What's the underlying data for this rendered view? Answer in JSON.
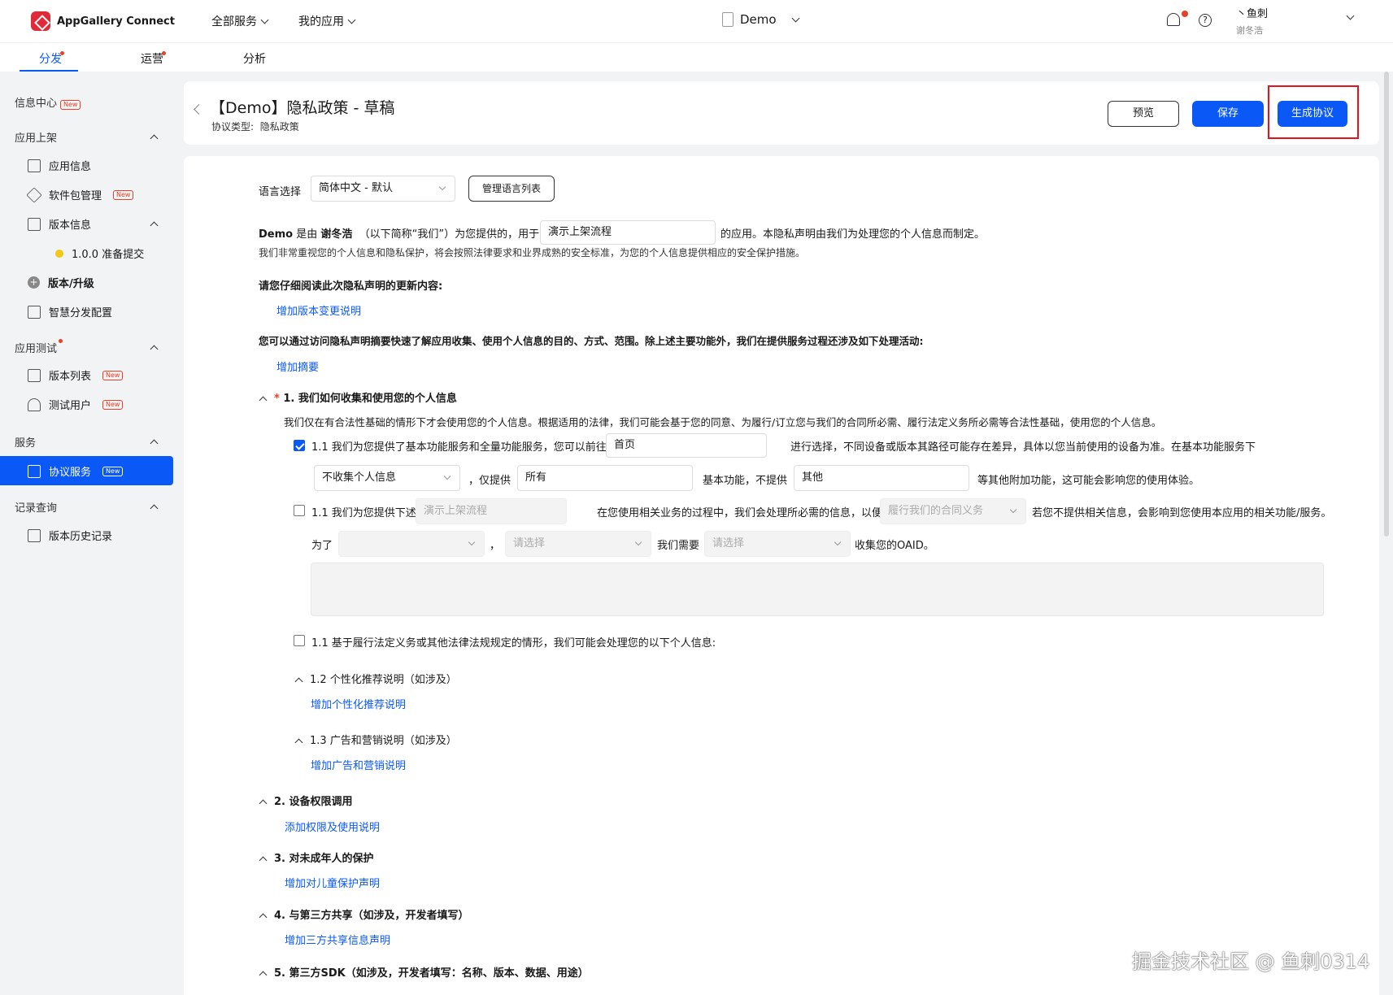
{
  "topbar": {
    "brand": "AppGallery Connect",
    "nav_all_services": "全部服务",
    "nav_my_apps": "我的应用",
    "project": "Demo",
    "user_name": "丶鱼刺",
    "user_sub": "谢冬浩"
  },
  "tabs": [
    "分发",
    "运营",
    "分析"
  ],
  "sidebar": {
    "info_center": "信息中心",
    "sec_release": "应用上架",
    "app_info": "应用信息",
    "package_mgmt": "软件包管理",
    "version_info": "版本信息",
    "version_item": "1.0.0 准备提交",
    "version_upgrade": "版本/升级",
    "smart_dist": "智慧分发配置",
    "sec_testing": "应用测试",
    "version_list": "版本列表",
    "test_users": "测试用户",
    "sec_services": "服务",
    "protocol_service": "协议服务",
    "sec_records": "记录查询",
    "version_history": "版本历史记录",
    "new_badge": "New"
  },
  "header": {
    "title": "【Demo】隐私政策 - 草稿",
    "subtitle_label": "协议类型:",
    "subtitle_value": "隐私政策",
    "preview_btn": "预览",
    "save_btn": "保存",
    "generate_btn": "生成协议"
  },
  "content": {
    "lang_label": "语言选择",
    "lang_value": "简体中文 - 默认",
    "manage_lang_btn": "管理语言列表",
    "intro_app": "Demo",
    "intro_is_by": " 是由 ",
    "intro_dev": "谢冬浩",
    "intro_mid": "（以下简称“我们”）为您提供的，用于",
    "intro_input": "演示上架流程",
    "intro_end": "的应用。本隐私声明由我们为处理您的个人信息而制定。",
    "intro_line2": "我们非常重视您的个人信息和隐私保护，将会按照法律要求和业界成熟的安全标准，为您的个人信息提供相应的安全保护措施。",
    "update_heading": "请您仔细阅读此次隐私声明的更新内容:",
    "add_version_link": "增加版本变更说明",
    "summary_heading": "您可以通过访问隐私声明摘要快速了解应用收集、使用个人信息的目的、方式、范围。除上述主要功能外，我们在提供服务过程还涉及如下处理活动:",
    "add_summary_link": "增加摘要",
    "s1_star": "*",
    "s1_title": "1. 我们如何收集和使用您的个人信息",
    "s1_desc": "我们仅在有合法性基础的情形下才会使用您的个人信息。根据适用的法律，我们可能会基于您的同意、为履行/订立您与我们的合同所必需、履行法定义务所必需等合法性基础，使用您的个人信息。",
    "c1_text": "1.1  我们为您提供了基本功能服务和全量功能服务，您可以前往",
    "c1_input": "首页",
    "c1_text2": "进行选择，不同设备或版本其路径可能存在差异，具体以您当前使用的设备为准。在基本功能服务下",
    "c1_select": "不收集个人信息",
    "c1_only": "，仅提供",
    "c1_input2": "所有",
    "c1_basic": "基本功能，不提供",
    "c1_input3": "其他",
    "c1_tail": "等其他附加功能，这可能会影响您的使用体验。",
    "c2_text": "1.1 我们为您提供下述",
    "c2_input": "演示上架流程",
    "c2_text2": "在您使用相关业务的过程中，我们会处理所必需的信息，以便",
    "c2_select": "履行我们的合同义务",
    "c2_text3": "若您不提供相关信息，会影响到您使用本应用的相关功能/服务。",
    "c2_for": "为了",
    "c2_comma": "，",
    "c2_select2": "请选择",
    "c2_need": "我们需要",
    "c2_select3": "请选择",
    "c2_oaid": "收集您的OAID。",
    "c3_text": "1.1 基于履行法定义务或其他法律法规规定的情形，我们可能会处理您的以下个人信息:",
    "s12_title": "1.2 个性化推荐说明（如涉及）",
    "s12_link": "增加个性化推荐说明",
    "s13_title": "1.3 广告和营销说明（如涉及）",
    "s13_link": "增加广告和营销说明",
    "s2_title": "2. 设备权限调用",
    "s2_link": "添加权限及使用说明",
    "s3_title": "3. 对未成年人的保护",
    "s3_link": "增加对儿童保护声明",
    "s4_title": "4. 与第三方共享（如涉及，开发者填写）",
    "s4_link": "增加三方共享信息声明",
    "s5_title": "5. 第三方SDK（如涉及，开发者填写：名称、版本、数据、用途）"
  },
  "watermark": "掘金技术社区 @ 鱼刺0314",
  "colors": {
    "primary": "#0a59f7",
    "alert": "#e84026",
    "highlight_box": "#e8121f"
  }
}
